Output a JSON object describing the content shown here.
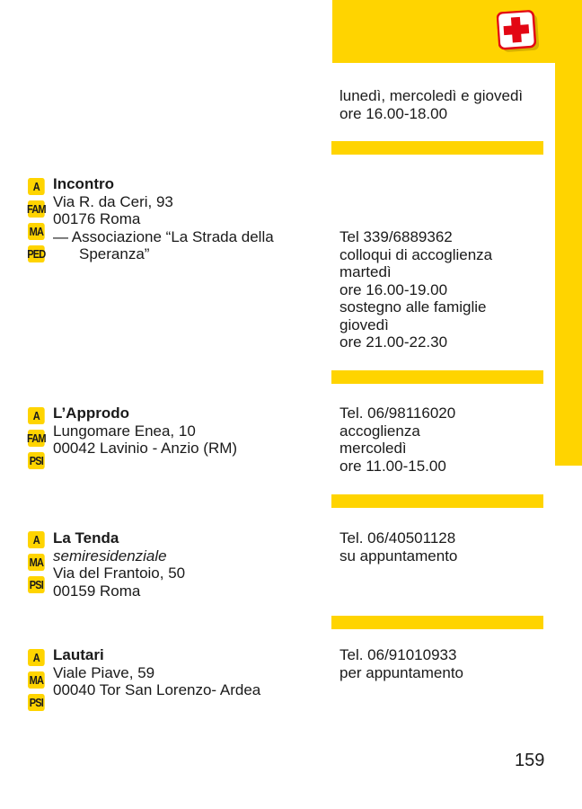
{
  "page_number": "159",
  "icons": {
    "header": "first-aid-icon"
  },
  "colors": {
    "accent": "#FFD400",
    "text": "#1a1a1a",
    "cross": "#E30613"
  },
  "intro_hours": [
    "lunedì, mercoledì e giovedì",
    "ore 16.00-18.00"
  ],
  "entries": [
    {
      "badges": [
        "A",
        "FAM",
        "MA",
        "PED"
      ],
      "name": "Incontro",
      "address": [
        "Via R. da Ceri, 93",
        "00176 Roma"
      ],
      "org": [
        "— Associazione “La Strada della",
        "Speranza”"
      ],
      "info": [
        "Tel 339/6889362",
        "colloqui di accoglienza",
        "martedì",
        "ore 16.00-19.00",
        "sostegno alle famiglie",
        "giovedì",
        "ore 21.00-22.30"
      ]
    },
    {
      "badges": [
        "A",
        "FAM",
        "PSI"
      ],
      "name": "L’Approdo",
      "address": [
        "Lungomare Enea, 10",
        "00042 Lavinio - Anzio (RM)"
      ],
      "info": [
        "Tel. 06/98116020",
        "accoglienza",
        "mercoledì",
        "ore 11.00-15.00"
      ]
    },
    {
      "badges": [
        "A",
        "MA",
        "PSI"
      ],
      "name": "La Tenda",
      "subtitle": "semiresidenziale",
      "address": [
        "Via del Frantoio, 50",
        "00159 Roma"
      ],
      "info": [
        "Tel. 06/40501128",
        "su appuntamento"
      ]
    },
    {
      "badges": [
        "A",
        "MA",
        "PSI"
      ],
      "name": "Lautari",
      "address": [
        "Viale Piave, 59",
        "00040 Tor San Lorenzo- Ardea"
      ],
      "info": [
        "Tel. 06/91010933",
        "per appuntamento"
      ]
    }
  ]
}
